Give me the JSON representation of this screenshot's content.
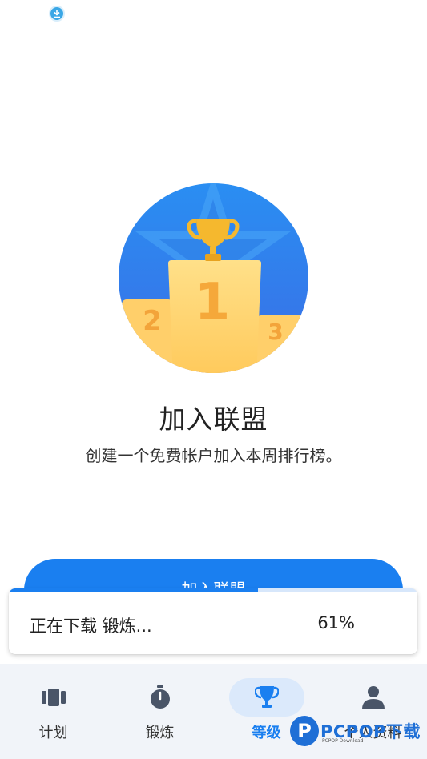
{
  "status_bar": {
    "download_icon": "download-circle-icon"
  },
  "hero": {
    "image": "podium-trophy-illustration",
    "podium_numbers": [
      "2",
      "1",
      "3"
    ]
  },
  "content": {
    "title": "加入联盟",
    "subtitle": "创建一个免费帐户加入本周排行榜。"
  },
  "join_button": {
    "label": "加入联盟"
  },
  "download_toast": {
    "text": "正在下载 锻炼...",
    "percent_label": "61%",
    "progress": 0.61
  },
  "bottom_nav": {
    "items": [
      {
        "label": "计划",
        "icon": "plan-icon",
        "active": false
      },
      {
        "label": "锻炼",
        "icon": "stopwatch-icon",
        "active": false
      },
      {
        "label": "等级",
        "icon": "trophy-icon",
        "active": true
      },
      {
        "label": "个人资料",
        "icon": "person-icon",
        "active": false
      }
    ]
  },
  "watermark": {
    "main": "PCPOP下载",
    "sub": "PCPOP Download"
  },
  "colors": {
    "accent": "#1a7ff0",
    "nav_bg": "#f1f4f9",
    "gold": "#f5b82e"
  }
}
